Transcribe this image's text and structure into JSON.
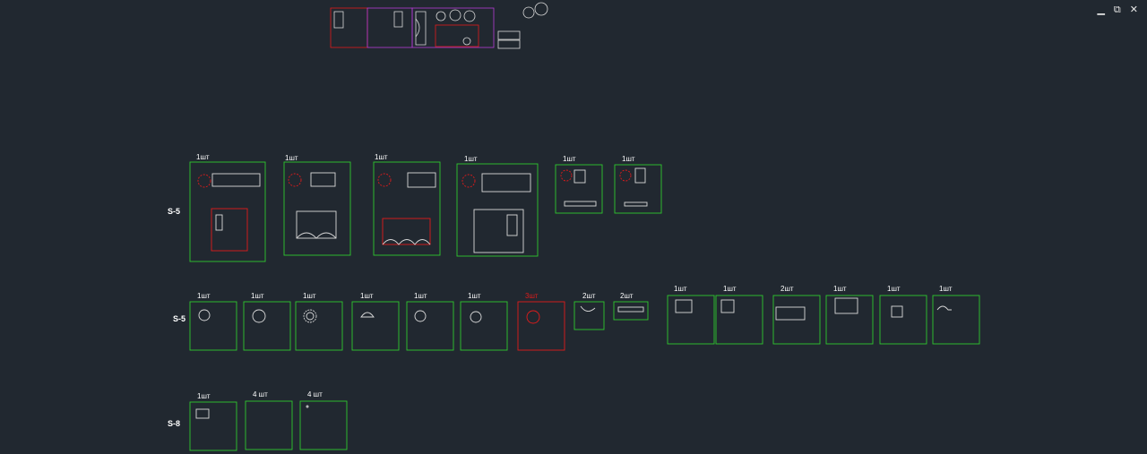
{
  "window_controls": {
    "minimize": "▁",
    "restore": "⧉",
    "close": "✕"
  },
  "row_labels": [
    "S-5",
    "S-5",
    "S-8"
  ],
  "row1_qty": [
    "1шт",
    "1шт",
    "1шт",
    "1шт",
    "1шт",
    "1шт"
  ],
  "row2_qty": [
    "1шт",
    "1шт",
    "1шт",
    "1шт",
    "1шт",
    "1шт",
    "3шт",
    "2шт",
    "2шт",
    "1шт",
    "1шт",
    "2шт",
    "1шт",
    "1шт",
    "1шт"
  ],
  "row3_qty": [
    "1шт",
    "4 шт",
    "4 шт"
  ],
  "colors": {
    "background": "#212830",
    "sheet_border": "#2fc82f",
    "highlight": "#e01b1b",
    "purple": "#b63bd6",
    "linework": "#d9d9d9"
  }
}
